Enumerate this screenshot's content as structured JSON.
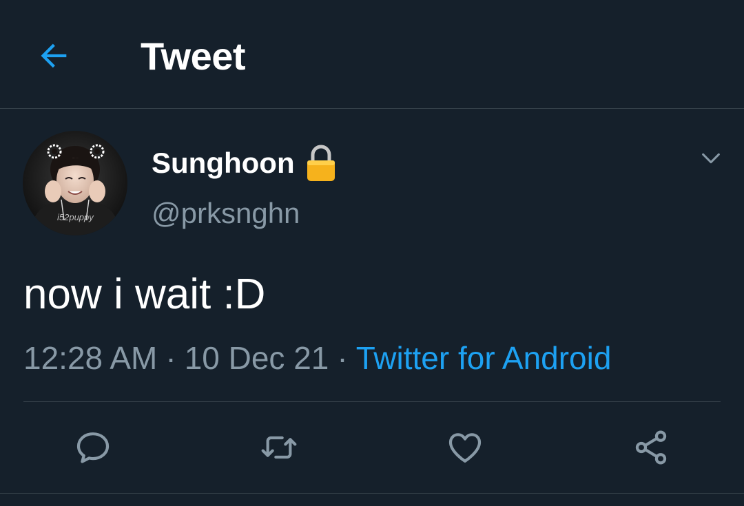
{
  "header": {
    "title": "Tweet",
    "back_icon": "arrow-left-icon"
  },
  "author": {
    "display_name": "Sunghoon",
    "handle": "@prksnghn",
    "protected_icon": "lock-icon",
    "avatar_watermark": "i52puppy"
  },
  "tweet": {
    "text": "now i wait :D",
    "time": "12:28 AM",
    "separator": "·",
    "date": "10 Dec 21",
    "source": "Twitter for Android"
  },
  "actions": [
    {
      "name": "reply",
      "icon": "reply-icon"
    },
    {
      "name": "retweet",
      "icon": "retweet-icon"
    },
    {
      "name": "like",
      "icon": "heart-icon"
    },
    {
      "name": "share",
      "icon": "share-icon"
    }
  ],
  "colors": {
    "background": "#15202b",
    "accent": "#1da1f2",
    "secondary_text": "#8899a6",
    "divider": "#38444d"
  }
}
